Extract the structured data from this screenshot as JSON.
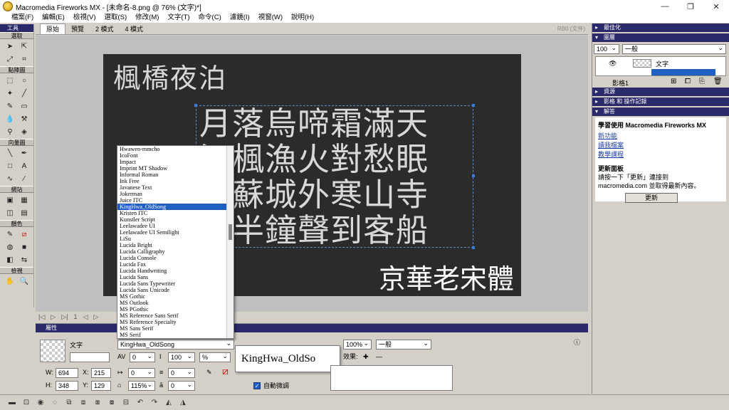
{
  "window": {
    "title": "Macromedia Fireworks MX - [未命名-8.png @  76% (文字)*]"
  },
  "menu": [
    "檔案(F)",
    "編輯(E)",
    "檢視(V)",
    "選取(S)",
    "修改(M)",
    "文字(T)",
    "命令(C)",
    "濾鏡(I)",
    "視窗(W)",
    "說明(H)"
  ],
  "toolbox": {
    "title": "工具",
    "sections": [
      "選取",
      "點陣圖",
      "向量圖",
      "網站",
      "顏色",
      "檢視"
    ]
  },
  "doc_tabs": [
    "原始",
    "預覽",
    "2 模式",
    "4 模式"
  ],
  "doc_right_text": "RB0 (文件)",
  "canvas": {
    "poem_title": "楓橋夜泊",
    "poem_lines": [
      "月落烏啼霜滿天",
      "江楓漁火對愁眠",
      "姑蘇城外寒山寺",
      "夜半鐘聲到客船"
    ],
    "font_label": "京華老宋體"
  },
  "font_list": {
    "options": [
      "Hwawen-mmcho",
      "IcoFont",
      "Impact",
      "Imprint MT Shadow",
      "Informal Roman",
      "Ink Free",
      "Javanese Text",
      "Jokerman",
      "Juice ITC",
      "KingHwa_OldSong",
      "Kristen ITC",
      "Kunstler Script",
      "Leelawadee UI",
      "Leelawadee UI Semilight",
      "LiSu",
      "Lucida Bright",
      "Lucida Calligraphy",
      "Lucida Console",
      "Lucida Fax",
      "Lucida Handwriting",
      "Lucida Sans",
      "Lucida Sans Typewriter",
      "Lucida Sans Unicode",
      "MS Gothic",
      "MS Outlook",
      "MS PGothic",
      "MS Reference Sans Serif",
      "MS Reference Specialty",
      "MS Sans Serif",
      "MS Serif"
    ],
    "selected_index": 9
  },
  "statusbar": {
    "frame": "1"
  },
  "properties": {
    "title": "屬性",
    "object_type": "文字",
    "w": "694",
    "x": "215",
    "h": "348",
    "y": "129",
    "font": "KingHwa_OldSong",
    "font_preview": "KingHwa_OldSo",
    "kerning": "0",
    "leading": "100",
    "opacity": "100%",
    "blend": "一般",
    "indent": "0",
    "space_before": "0",
    "space_after": "0",
    "h_scale": "115%",
    "baseline": "0",
    "auto_kern": "自動微調",
    "effects": "效果:"
  },
  "right_panel": {
    "optimize": "最佳化",
    "layers": "圖層",
    "opacity": "100",
    "blend": "一般",
    "layer_name": "文字",
    "frame": "影格1",
    "assets": "資源",
    "history": "影格 和 操作記錄",
    "answers": "解答",
    "help_title": "學習使用 Macromedia Fireworks MX",
    "links": [
      "新功能",
      "讀我檔案",
      "教學課程"
    ],
    "update_title": "更新面板",
    "update_text1": "請按一下「更新」連接到",
    "update_text2": "macromedia.com 並取得最新內容。",
    "update_button": "更新"
  },
  "colors": {
    "canvas": "#2b2b2b",
    "selection": "#1f5fc2",
    "panel": "#d4d0c8",
    "panel_title": "#2a2a6a"
  }
}
